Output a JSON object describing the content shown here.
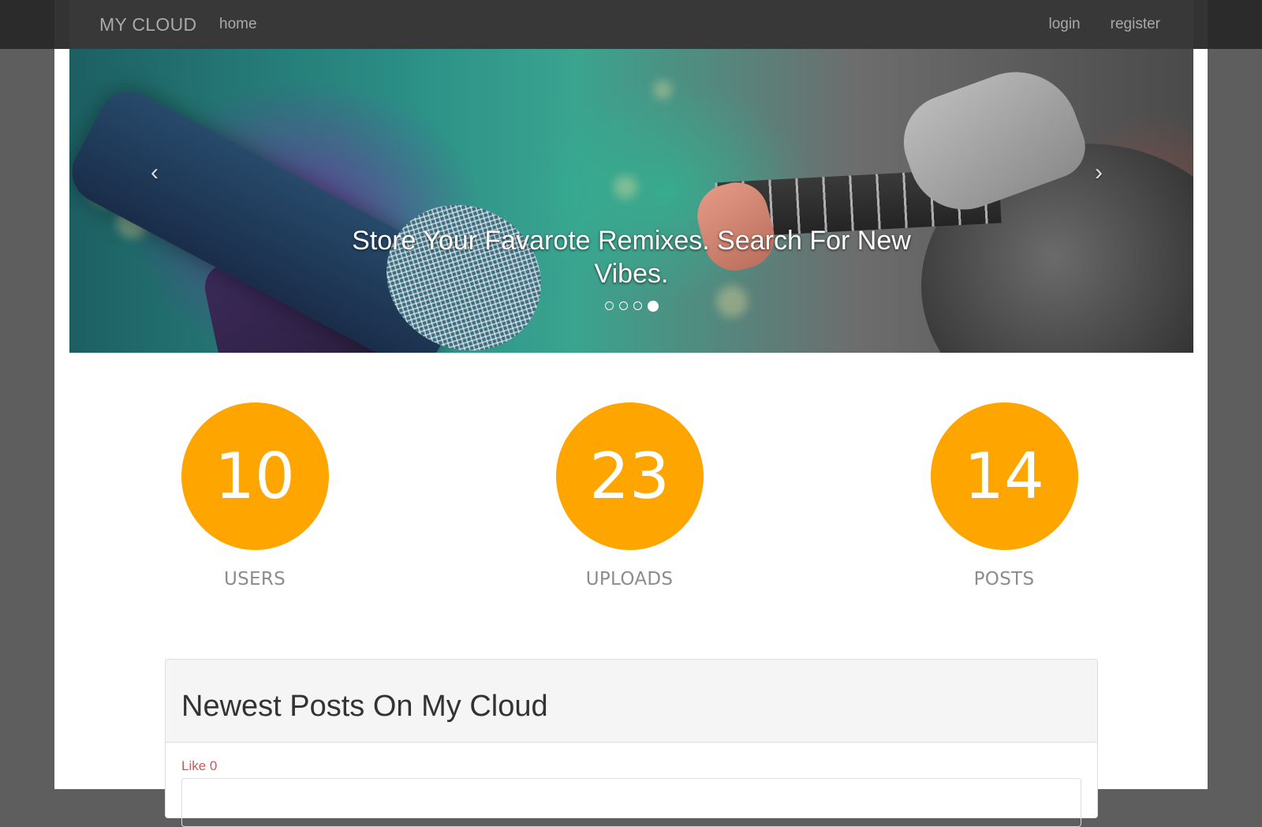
{
  "navbar": {
    "brand": "MY CLOUD",
    "home_label": "home",
    "login_label": "login",
    "register_label": "register"
  },
  "carousel": {
    "caption": "Store Your Favarote Remixes. Search For New Vibes.",
    "prev_label": "‹",
    "next_label": "›",
    "slide_count": 4,
    "active_slide": 4
  },
  "stats": [
    {
      "value": "10",
      "label": "USERS"
    },
    {
      "value": "23",
      "label": "UPLOADS"
    },
    {
      "value": "14",
      "label": "POSTS"
    }
  ],
  "posts_panel": {
    "title": "Newest Posts On My Cloud",
    "like_label": "Like 0"
  },
  "colors": {
    "stat_circle": "#ffa500",
    "like_link": "#d9534f",
    "navbar": "#282828"
  }
}
